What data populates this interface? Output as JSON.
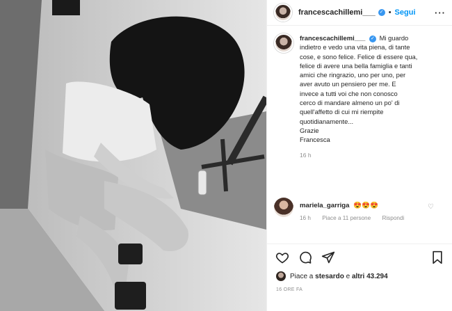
{
  "post": {
    "username": "francescachillemi___",
    "follow_label": "Segui",
    "separator": "•",
    "more_label": "···"
  },
  "caption": {
    "username": "francescachillemi___",
    "lines": [
      "Mi guardo",
      "indietro e vedo una vita piena, di tante",
      "cose, e sono felice. Felice di essere qua,",
      "felice di avere una bella famiglia e tanti",
      "amici che ringrazio, uno per uno, per",
      "aver avuto un pensiero per me. E",
      "invece a tutti voi che non conosco",
      "cerco di mandare almeno un po' di",
      "quell'affetto di cui mi riempite",
      "quotidianamente...",
      "Grazie",
      "Francesca"
    ],
    "time": "16 h"
  },
  "comment": {
    "username": "mariela_garriga",
    "text": "😍😍😍",
    "time": "16 h",
    "likes": "Piace a 11 persone",
    "reply_label": "Rispondi"
  },
  "actions": {
    "likes_prefix": "Piace a ",
    "likes_user": "stesardo",
    "likes_middle": " e ",
    "likes_others": "altri 43.294",
    "timestamp": "16 ORE FA"
  },
  "icons": {
    "like": "heart-icon",
    "comment": "comment-icon",
    "share": "share-icon",
    "save": "bookmark-icon",
    "verified": "verified-badge-icon"
  },
  "colors": {
    "accent": "#0095f6",
    "verified": "#3897f0",
    "muted": "#8e8e8e",
    "text": "#262626"
  }
}
